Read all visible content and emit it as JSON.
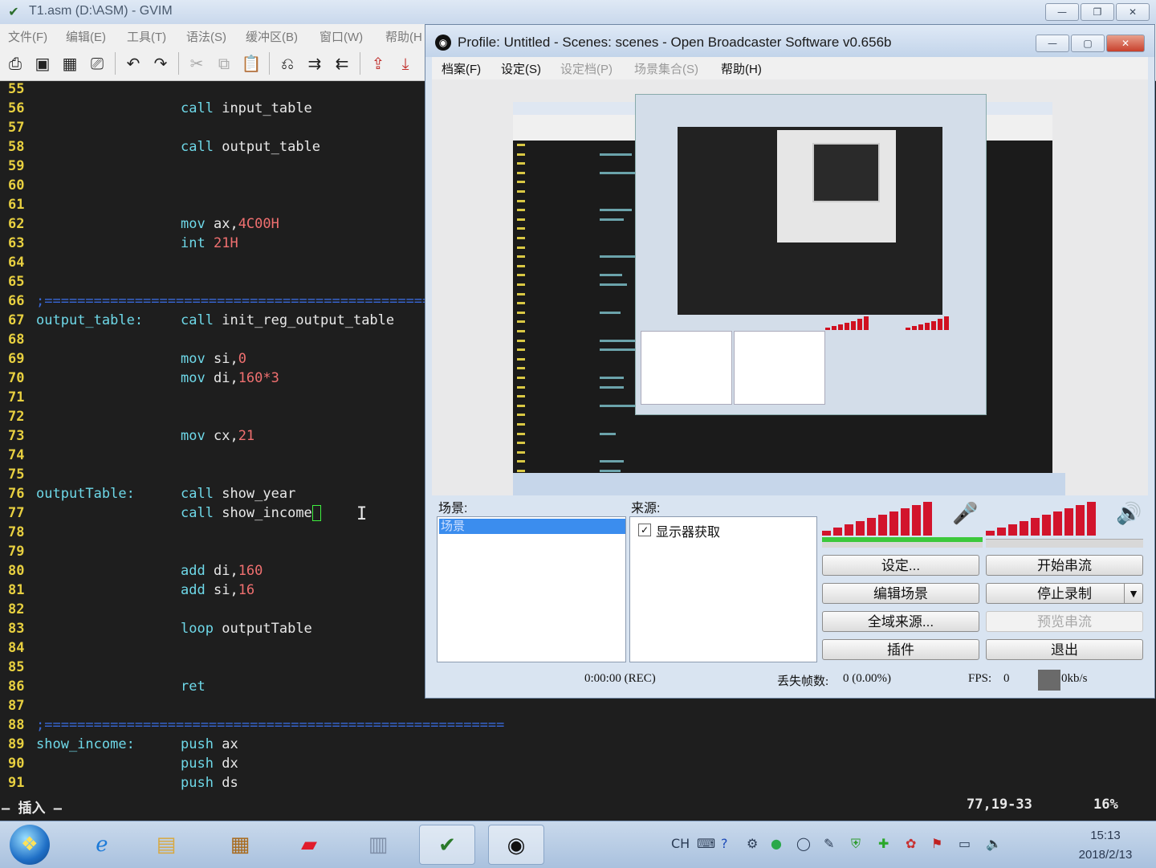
{
  "gvim": {
    "title": "T1.asm (D:\\ASM) - GVIM",
    "menu": [
      "文件(F)",
      "编辑(E)",
      "工具(T)",
      "语法(S)",
      "缓冲区(B)",
      "窗口(W)",
      "帮助(H"
    ],
    "lines": [
      {
        "n": "55"
      },
      {
        "n": "56",
        "ins": "call",
        "arg": "input_table"
      },
      {
        "n": "57"
      },
      {
        "n": "58",
        "ins": "call",
        "arg": "output_table"
      },
      {
        "n": "59"
      },
      {
        "n": "60"
      },
      {
        "n": "61"
      },
      {
        "n": "62",
        "ins": "mov",
        "arg": "ax,",
        "num": "4C00H"
      },
      {
        "n": "63",
        "ins": "int",
        "num": "21H"
      },
      {
        "n": "64"
      },
      {
        "n": "65"
      },
      {
        "n": "66",
        "cmt": ";===================================================="
      },
      {
        "n": "67",
        "lbl": "output_table:",
        "ins": "call",
        "arg": "init_reg_output_table"
      },
      {
        "n": "68"
      },
      {
        "n": "69",
        "ins": "mov",
        "arg": "si,",
        "num": "0"
      },
      {
        "n": "70",
        "ins": "mov",
        "arg": "di,",
        "num": "160*3"
      },
      {
        "n": "71"
      },
      {
        "n": "72"
      },
      {
        "n": "73",
        "ins": "mov",
        "arg": "cx,",
        "num": "21"
      },
      {
        "n": "74"
      },
      {
        "n": "75"
      },
      {
        "n": "76",
        "lbl": "outputTable:",
        "ins": "call",
        "arg": "show_year"
      },
      {
        "n": "77",
        "ins": "call",
        "arg": "show_income",
        "cursor": true
      },
      {
        "n": "78"
      },
      {
        "n": "79"
      },
      {
        "n": "80",
        "ins": "add",
        "arg": "di,",
        "num": "160"
      },
      {
        "n": "81",
        "ins": "add",
        "arg": "si,",
        "num": "16"
      },
      {
        "n": "82"
      },
      {
        "n": "83",
        "ins": "loop",
        "arg": "outputTable"
      },
      {
        "n": "84"
      },
      {
        "n": "85"
      },
      {
        "n": "86",
        "ins": "ret"
      },
      {
        "n": "87"
      },
      {
        "n": "88",
        "cmt": ";========================================================"
      },
      {
        "n": "89",
        "lbl": "show_income:",
        "ins": "push",
        "arg": "ax"
      },
      {
        "n": "90",
        "ins": "push",
        "arg": "dx"
      },
      {
        "n": "91",
        "ins": "push",
        "arg": "ds"
      }
    ],
    "status": {
      "mode": "— 插入 —",
      "position": "77,19-33",
      "percent": "16%"
    }
  },
  "obs": {
    "title": "Profile: Untitled - Scenes: scenes - Open Broadcaster Software v0.656b",
    "menu": [
      {
        "label": "档案(F)",
        "enabled": true
      },
      {
        "label": "设定(S)",
        "enabled": true
      },
      {
        "label": "设定档(P)",
        "enabled": false
      },
      {
        "label": "场景集合(S)",
        "enabled": false
      },
      {
        "label": "帮助(H)",
        "enabled": true
      }
    ],
    "scenes_label": "场景:",
    "scenes": [
      "场景"
    ],
    "sources_label": "来源:",
    "sources": [
      {
        "label": "显示器获取",
        "checked": true
      }
    ],
    "buttons": {
      "settings": "设定...",
      "start_stream": "开始串流",
      "edit_scene": "编辑场景",
      "stop_record": "停止录制",
      "global_sources": "全域来源...",
      "preview_stream": "预览串流",
      "plugins": "插件",
      "exit": "退出"
    },
    "status": {
      "time": "0:00:00  (REC)",
      "dropped_label": "丢失帧数:",
      "dropped_value": "0  (0.00%)",
      "fps_label": "FPS:",
      "fps_value": "0",
      "bitrate": "0kb/s"
    },
    "colors": {
      "meter": "#d2142c",
      "volume": "#3cc83c",
      "selection": "#3b8dee"
    }
  },
  "taskbar": {
    "apps": [
      "start-orb",
      "internet-explorer-icon",
      "file-explorer-icon",
      "dosbox-icon",
      "youdao-icon",
      "calculator-icon",
      "gvim-icon",
      "obs-icon"
    ],
    "tray_lang": "CH",
    "clock_time": "15:13",
    "clock_date": "2018/2/13"
  }
}
